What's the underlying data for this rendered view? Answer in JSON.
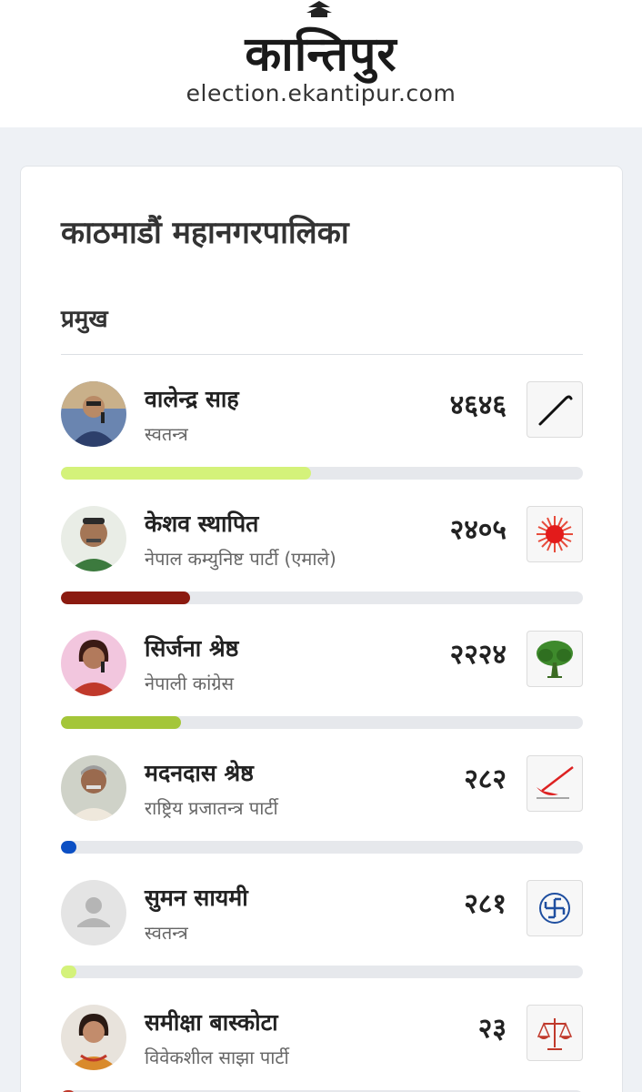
{
  "header": {
    "logo_text": "कान्तिपुर",
    "site_url": "election.ekantipur.com"
  },
  "card": {
    "title": "काठमाडौं महानगरपालिका",
    "section": "प्रमुख"
  },
  "candidates": [
    {
      "name": "वालेन्द्र साह",
      "party": "स्वतन्त्र",
      "votes": "४६४६",
      "votes_value": 4646,
      "symbol": "walking-stick-icon",
      "bar_color": "#d4f27a",
      "avatar": "photo-man-mic"
    },
    {
      "name": "केशव स्थापित",
      "party": "नेपाल कम्युनिष्ट पार्टी (एमाले)",
      "votes": "२४०५",
      "votes_value": 2405,
      "symbol": "sun-icon",
      "bar_color": "#8b1a10",
      "avatar": "photo-man-beard"
    },
    {
      "name": "सिर्जना श्रेष्ठ",
      "party": "नेपाली कांग्रेस",
      "votes": "२२२४",
      "votes_value": 2224,
      "symbol": "tree-icon",
      "bar_color": "#a4c639",
      "avatar": "photo-woman-mic"
    },
    {
      "name": "मदनदास श्रेष्ठ",
      "party": "राष्ट्रिय प्रजातन्त्र पार्टी",
      "votes": "२८२",
      "votes_value": 282,
      "symbol": "plough-icon",
      "bar_color": "#0b4fc4",
      "avatar": "photo-old-man"
    },
    {
      "name": "सुमन सायमी",
      "party": "स्वतन्त्र",
      "votes": "२८१",
      "votes_value": 281,
      "symbol": "swastika-icon",
      "bar_color": "#d4f27a",
      "avatar": "placeholder"
    },
    {
      "name": "समीक्षा बास्कोटा",
      "party": "विवेकशील साझा पार्टी",
      "votes": "२३",
      "votes_value": 23,
      "symbol": "scales-icon",
      "bar_color": "#c0392b",
      "avatar": "photo-woman"
    }
  ],
  "max_votes": 9700
}
